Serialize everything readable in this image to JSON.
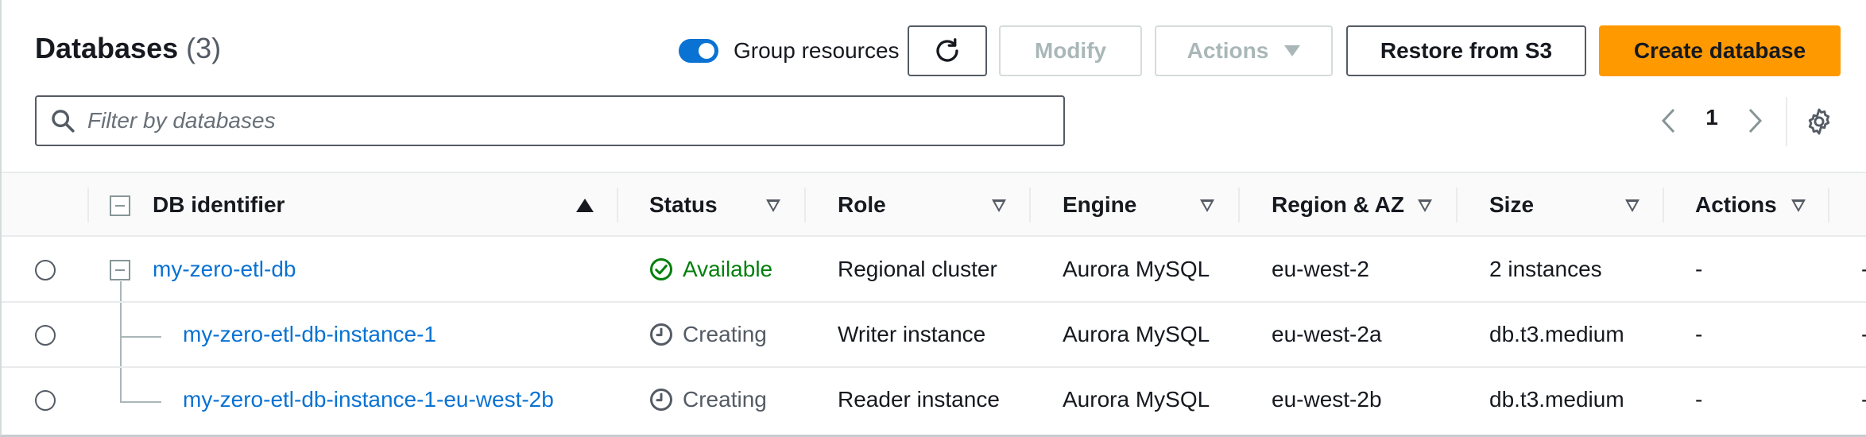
{
  "header": {
    "title": "Databases",
    "count": "(3)",
    "group_toggle_label": "Group resources",
    "group_toggle_on": true,
    "buttons": {
      "refresh_icon": "refresh-icon",
      "modify": "Modify",
      "actions": "Actions",
      "restore": "Restore from S3",
      "create": "Create database"
    }
  },
  "filter": {
    "placeholder": "Filter by databases",
    "value": ""
  },
  "pagination": {
    "current_page": "1"
  },
  "colors": {
    "primary": "#ff9900",
    "link": "#0972d3",
    "available": "#037f0c",
    "toggle": "#0972d3"
  },
  "table": {
    "columns": [
      "DB identifier",
      "Status",
      "Role",
      "Engine",
      "Region & AZ",
      "Size",
      "Actions"
    ],
    "rows": [
      {
        "identifier": "my-zero-etl-db",
        "status": "Available",
        "status_icon": "check-circle-icon",
        "role": "Regional cluster",
        "engine": "Aurora MySQL",
        "region": "eu-west-2",
        "size": "2 instances",
        "actions": "-",
        "extra": "-"
      },
      {
        "identifier": "my-zero-etl-db-instance-1",
        "status": "Creating",
        "status_icon": "clock-icon",
        "role": "Writer instance",
        "engine": "Aurora MySQL",
        "region": "eu-west-2a",
        "size": "db.t3.medium",
        "actions": "-",
        "extra": "-"
      },
      {
        "identifier": "my-zero-etl-db-instance-1-eu-west-2b",
        "status": "Creating",
        "status_icon": "clock-icon",
        "role": "Reader instance",
        "engine": "Aurora MySQL",
        "region": "eu-west-2b",
        "size": "db.t3.medium",
        "actions": "-",
        "extra": "-"
      }
    ]
  }
}
